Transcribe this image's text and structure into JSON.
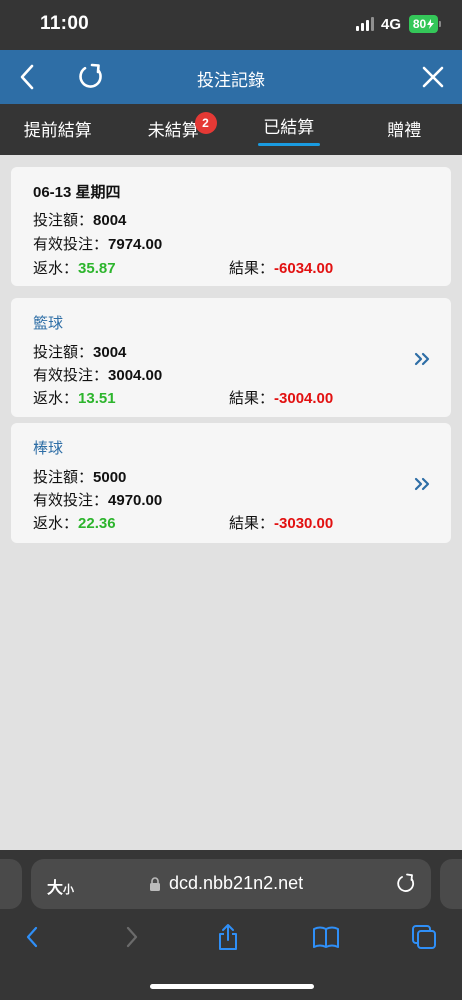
{
  "status": {
    "time": "11:00",
    "network": "4G",
    "battery": "80"
  },
  "header": {
    "title": "投注記錄"
  },
  "tabs": [
    {
      "label": "提前結算",
      "active": false
    },
    {
      "label": "未結算",
      "active": false,
      "badge": "2"
    },
    {
      "label": "已結算",
      "active": true
    },
    {
      "label": "贈禮",
      "active": false
    }
  ],
  "summary": {
    "date": "06-13 星期四",
    "bet_label": "投注額：",
    "bet": "8004",
    "valid_label": "有效投注：",
    "valid": "7974.00",
    "rebate_label": "返水：",
    "rebate": "35.87",
    "result_label": "結果：",
    "result": "-6034.00"
  },
  "items": [
    {
      "sport": "籃球",
      "bet_label": "投注額：",
      "bet": "3004",
      "valid_label": "有效投注：",
      "valid": "3004.00",
      "rebate_label": "返水：",
      "rebate": "13.51",
      "result_label": "結果：",
      "result": "-3004.00"
    },
    {
      "sport": "棒球",
      "bet_label": "投注額：",
      "bet": "5000",
      "valid_label": "有效投注：",
      "valid": "4970.00",
      "rebate_label": "返水：",
      "rebate": "22.36",
      "result_label": "結果：",
      "result": "-3030.00"
    }
  ],
  "browser": {
    "text_size": "大",
    "text_size_small": "小",
    "url": "dcd.nbb21n2.net"
  },
  "colors": {
    "header": "#2e6ea6",
    "tab_bar": "#353535",
    "active_underline": "#1a9be0",
    "badge": "#e53935",
    "positive": "#2db52d",
    "negative": "#e21111",
    "background": "#e1e1e1"
  },
  "icons": [
    "back-icon",
    "refresh-icon",
    "close-icon",
    "double-chevron-right-icon",
    "lock-icon",
    "reload-icon",
    "share-icon",
    "bookmarks-icon",
    "tabs-icon"
  ]
}
